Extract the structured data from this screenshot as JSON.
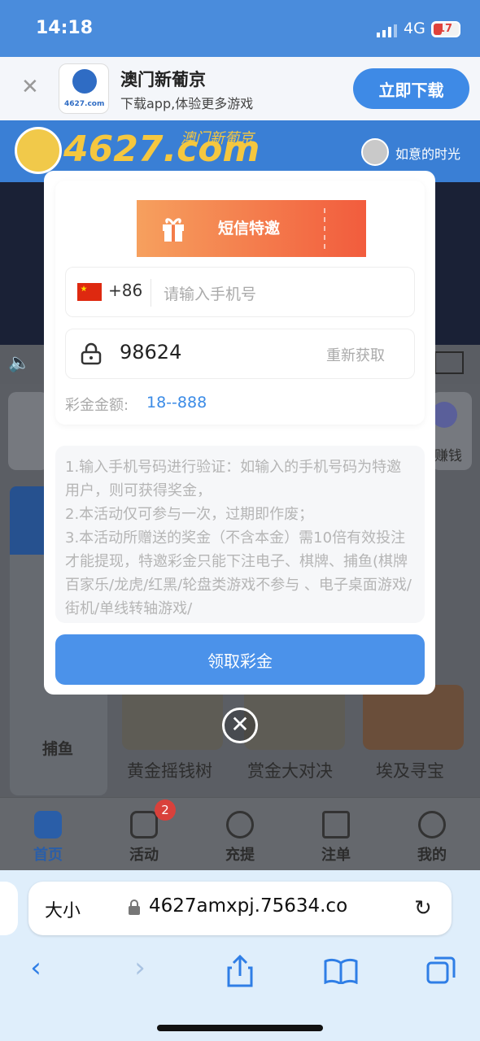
{
  "status_bar": {
    "time": "14:18",
    "network": "4G",
    "battery": "17"
  },
  "app_banner": {
    "title": "澳门新葡京",
    "subtitle": "下载app,体验更多游戏",
    "download_label": "立即下载",
    "logo_text": "4627.com"
  },
  "site_header": {
    "brand": "4627.com",
    "brand_sub": "澳门新葡京",
    "username": "如意的时光"
  },
  "background_page": {
    "side_labels": [
      "捕鱼",
      "赚钱"
    ],
    "game_titles": [
      "黄金摇钱树",
      "赏金大对决",
      "埃及寻宝"
    ]
  },
  "tab_bar": {
    "tabs": [
      {
        "label": "首页",
        "icon": "home-icon",
        "active": true
      },
      {
        "label": "活动",
        "icon": "star-icon",
        "badge": "2"
      },
      {
        "label": "充提",
        "icon": "target-icon"
      },
      {
        "label": "注单",
        "icon": "receipt-icon"
      },
      {
        "label": "我的",
        "icon": "profile-icon"
      }
    ]
  },
  "browser": {
    "text_size": "大小",
    "url": "4627amxpj.75634.co"
  },
  "modal": {
    "ticket_title": "短信特邀",
    "country_code": "+86",
    "phone_placeholder": "请输入手机号",
    "code_value": "98624",
    "resend_label": "重新获取",
    "amount_label": "彩金金额:",
    "amount_value": "18--888",
    "rules": "1.输入手机号码进行验证：如输入的手机号码为特邀用户，则可获得奖金，\n2.本活动仅可参与一次，过期即作废；\n3.本活动所赠送的奖金（不含本金）需10倍有效投注才能提现，特邀彩金只能下注电子、棋牌、捕鱼(棋牌百家乐/龙虎/红黑/轮盘类游戏不参与 、电子桌面游戏/街机/单线转轴游戏/",
    "claim_label": "领取彩金"
  },
  "colors": {
    "accent": "#4b92ea",
    "ticket_start": "#f6a05e",
    "ticket_end": "#f25c3d"
  }
}
